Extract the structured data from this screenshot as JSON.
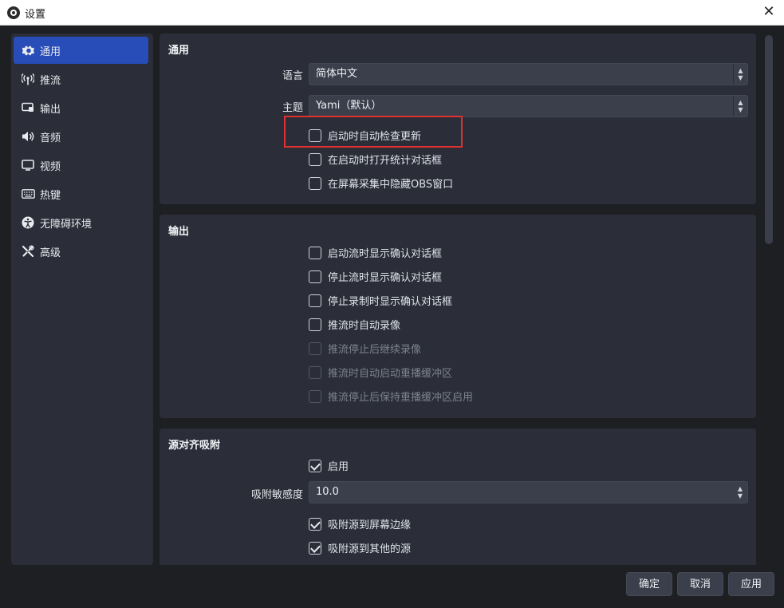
{
  "window": {
    "title": "设置"
  },
  "sidebar": {
    "items": [
      {
        "label": "通用",
        "icon": "gear-icon",
        "active": true
      },
      {
        "label": "推流",
        "icon": "antenna-icon"
      },
      {
        "label": "输出",
        "icon": "output-icon"
      },
      {
        "label": "音频",
        "icon": "speaker-icon"
      },
      {
        "label": "视频",
        "icon": "monitor-icon"
      },
      {
        "label": "热键",
        "icon": "keyboard-icon"
      },
      {
        "label": "无障碍环境",
        "icon": "accessibility-icon"
      },
      {
        "label": "高级",
        "icon": "tools-icon"
      }
    ]
  },
  "general": {
    "title": "通用",
    "language_label": "语言",
    "language_value": "简体中文",
    "theme_label": "主题",
    "theme_value": "Yami（默认）",
    "checks": [
      {
        "label": "启动时自动检查更新",
        "checked": false
      },
      {
        "label": "在启动时打开统计对话框",
        "checked": false
      },
      {
        "label": "在屏幕采集中隐藏OBS窗口",
        "checked": false
      }
    ]
  },
  "output": {
    "title": "输出",
    "checks": [
      {
        "label": "启动流时显示确认对话框",
        "checked": false
      },
      {
        "label": "停止流时显示确认对话框",
        "checked": false
      },
      {
        "label": "停止录制时显示确认对话框",
        "checked": false
      },
      {
        "label": "推流时自动录像",
        "checked": false
      },
      {
        "label": "推流停止后继续录像",
        "checked": false,
        "disabled": true
      },
      {
        "label": "推流时自动启动重播缓冲区",
        "checked": false,
        "disabled": true
      },
      {
        "label": "推流停止后保持重播缓冲区启用",
        "checked": false,
        "disabled": true
      }
    ]
  },
  "snapping": {
    "title": "源对齐吸附",
    "enable_label": "启用",
    "sensitivity_label": "吸附敏感度",
    "sensitivity_value": "10.0",
    "checks": [
      {
        "label": "吸附源到屏幕边缘",
        "checked": true
      },
      {
        "label": "吸附源到其他的源",
        "checked": true
      }
    ]
  },
  "footer": {
    "ok_label": "确定",
    "cancel_label": "取消",
    "apply_label": "应用"
  }
}
